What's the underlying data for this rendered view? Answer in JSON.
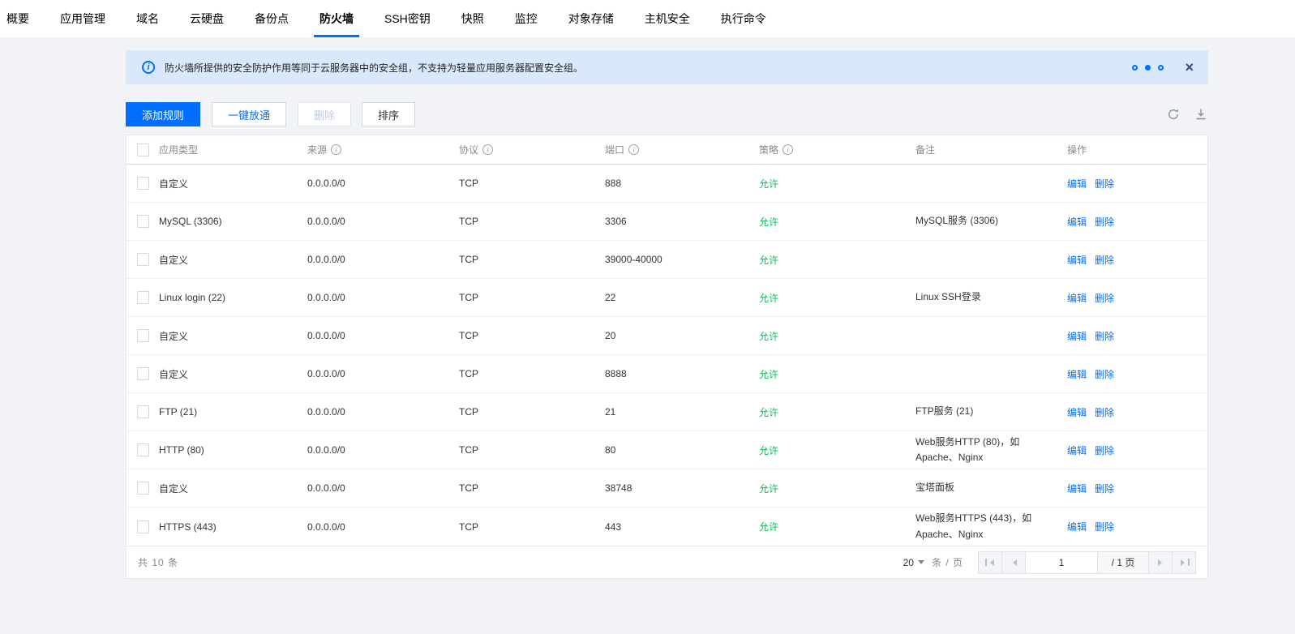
{
  "nav": {
    "tabs": [
      {
        "label": "概要",
        "active": false
      },
      {
        "label": "应用管理",
        "active": false
      },
      {
        "label": "域名",
        "active": false
      },
      {
        "label": "云硬盘",
        "active": false
      },
      {
        "label": "备份点",
        "active": false
      },
      {
        "label": "防火墙",
        "active": true
      },
      {
        "label": "SSH密钥",
        "active": false
      },
      {
        "label": "快照",
        "active": false
      },
      {
        "label": "监控",
        "active": false
      },
      {
        "label": "对象存储",
        "active": false
      },
      {
        "label": "主机安全",
        "active": false
      },
      {
        "label": "执行命令",
        "active": false
      }
    ]
  },
  "banner": {
    "text": "防火墙所提供的安全防护作用等同于云服务器中的安全组，不支持为轻量应用服务器配置安全组。"
  },
  "toolbar": {
    "add_rule": "添加规则",
    "open_all": "一键放通",
    "delete": "删除",
    "sort": "排序"
  },
  "icons": {
    "banner": "info-icon",
    "close": "close-icon",
    "refresh": "refresh-icon",
    "download": "download-icon"
  },
  "colors": {
    "accent_blue": "#006eff",
    "policy_green": "#0abf5b",
    "banner_bg": "#d9e8fb",
    "page_bg": "#f2f3f7"
  },
  "table": {
    "columns": [
      "应用类型",
      "来源",
      "协议",
      "端口",
      "策略",
      "备注",
      "操作"
    ],
    "actions": {
      "edit": "编辑",
      "delete": "删除"
    },
    "rows": [
      {
        "app": "自定义",
        "source": "0.0.0.0/0",
        "protocol": "TCP",
        "port": "888",
        "policy": "允许",
        "remark": ""
      },
      {
        "app": "MySQL (3306)",
        "source": "0.0.0.0/0",
        "protocol": "TCP",
        "port": "3306",
        "policy": "允许",
        "remark": "MySQL服务 (3306)"
      },
      {
        "app": "自定义",
        "source": "0.0.0.0/0",
        "protocol": "TCP",
        "port": "39000-40000",
        "policy": "允许",
        "remark": ""
      },
      {
        "app": "Linux login (22)",
        "source": "0.0.0.0/0",
        "protocol": "TCP",
        "port": "22",
        "policy": "允许",
        "remark": "Linux SSH登录"
      },
      {
        "app": "自定义",
        "source": "0.0.0.0/0",
        "protocol": "TCP",
        "port": "20",
        "policy": "允许",
        "remark": ""
      },
      {
        "app": "自定义",
        "source": "0.0.0.0/0",
        "protocol": "TCP",
        "port": "8888",
        "policy": "允许",
        "remark": ""
      },
      {
        "app": "FTP (21)",
        "source": "0.0.0.0/0",
        "protocol": "TCP",
        "port": "21",
        "policy": "允许",
        "remark": "FTP服务 (21)"
      },
      {
        "app": "HTTP (80)",
        "source": "0.0.0.0/0",
        "protocol": "TCP",
        "port": "80",
        "policy": "允许",
        "remark": "Web服务HTTP (80)，如 Apache、Nginx"
      },
      {
        "app": "自定义",
        "source": "0.0.0.0/0",
        "protocol": "TCP",
        "port": "38748",
        "policy": "允许",
        "remark": "宝塔面板"
      },
      {
        "app": "HTTPS (443)",
        "source": "0.0.0.0/0",
        "protocol": "TCP",
        "port": "443",
        "policy": "允许",
        "remark": "Web服务HTTPS (443)，如 Apache、Nginx"
      }
    ]
  },
  "footer": {
    "total": "共 10 条",
    "page_size": "20",
    "unit": "条 / 页",
    "current_page": "1",
    "page_total": "/ 1 页"
  }
}
